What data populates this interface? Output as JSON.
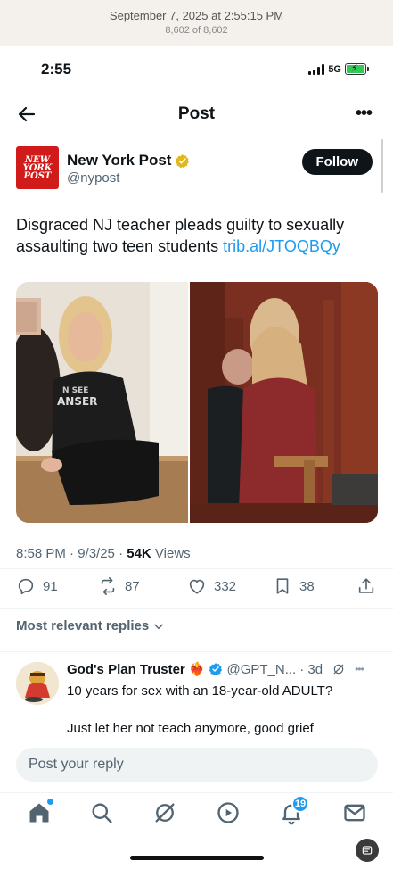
{
  "capture": {
    "date": "September 7, 2025 at 2:55:15 PM",
    "count": "8,602 of 8,602"
  },
  "status": {
    "time": "2:55",
    "network": "5G"
  },
  "header": {
    "title": "Post"
  },
  "author": {
    "name": "New York Post",
    "handle": "@nypost",
    "follow_label": "Follow",
    "logo_lines": [
      "NEW",
      "YORK",
      "POST"
    ]
  },
  "post": {
    "text": "Disgraced NJ teacher pleads guilty to sexually assaulting two teen students ",
    "link": "trib.al/JTOQBQy",
    "time": "8:58 PM · 9/3/25 · ",
    "views_count": "54K",
    "views_label": " Views"
  },
  "actions": {
    "replies": "91",
    "reposts": "87",
    "likes": "332",
    "bookmarks": "38"
  },
  "replies_filter": {
    "label": "Most relevant replies"
  },
  "reply": {
    "name": "God's Plan Truster",
    "emoji": "❤️‍🔥",
    "handle": "@GPT_N...",
    "age": "· 3d",
    "line1": "10 years for sex with an 18-year-old ADULT?",
    "line2": "Just let her not teach anymore, good grief"
  },
  "compose": {
    "placeholder": "Post your reply"
  },
  "tabbar": {
    "notifications_badge": "19"
  },
  "colors": {
    "accent": "#1d9bf0",
    "brand": "#d11b1b",
    "follow_bg": "#0f1419"
  }
}
